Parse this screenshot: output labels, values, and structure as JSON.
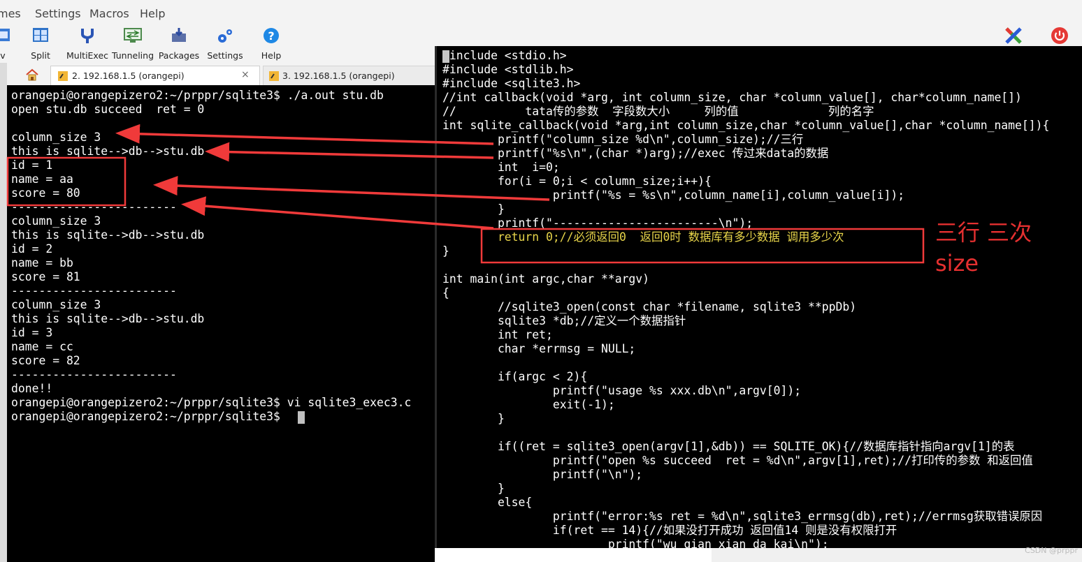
{
  "menu": [
    "mes",
    "Settings",
    "Macros",
    "Help"
  ],
  "toolbar": [
    {
      "label": "v",
      "icon": "view-icon"
    },
    {
      "label": "Split",
      "icon": "split-icon"
    },
    {
      "label": "MultiExec",
      "icon": "multiexec-icon"
    },
    {
      "label": "Tunneling",
      "icon": "tunneling-icon"
    },
    {
      "label": "Packages",
      "icon": "packages-icon"
    },
    {
      "label": "Settings",
      "icon": "settings-icon"
    },
    {
      "label": "Help",
      "icon": "help-icon"
    }
  ],
  "tabs": [
    {
      "label": "2. 192.168.1.5 (orangepi)",
      "close": "×"
    },
    {
      "label": "3. 192.168.1.5  (orangepi)"
    }
  ],
  "terminal": [
    "orangepi@orangepizero2:~/prppr/sqlite3$ ./a.out stu.db",
    "open stu.db succeed  ret = 0",
    "",
    "column_size 3",
    "this is sqlite-->db-->stu.db",
    "id = 1",
    "name = aa",
    "score = 80",
    "------------------------",
    "column_size 3",
    "this is sqlite-->db-->stu.db",
    "id = 2",
    "name = bb",
    "score = 81",
    "------------------------",
    "column_size 3",
    "this is sqlite-->db-->stu.db",
    "id = 3",
    "name = cc",
    "score = 82",
    "------------------------",
    "done!!",
    "orangepi@orangepizero2:~/prppr/sqlite3$ vi sqlite3_exec3.c",
    "orangepi@orangepizero2:~/prppr/sqlite3$ "
  ],
  "editor": {
    "l01": "#include <stdio.h>",
    "l02": "#include <stdlib.h>",
    "l03": "#include <sqlite3.h>",
    "l04": "//int callback(void *arg, int column_size, char *column_value[], char*column_name[])",
    "l05": "//          tata传的参数  字段数大小     列的值             列的名字",
    "l06": "int sqlite_callback(void *arg,int column_size,char *column_value[],char *column_name[]){",
    "l07": "        printf(\"column_size %d\\n\",column_size);//三行",
    "l08": "        printf(\"%s\\n\",(char *)arg);//exec 传过来data的数据",
    "l09": "        int  i=0;",
    "l10": "        for(i = 0;i < column_size;i++){",
    "l11": "                printf(\"%s = %s\\n\",column_name[i],column_value[i]);",
    "l12": "        }",
    "l13": "        printf(\"------------------------\\n\");",
    "l14": "        return 0;//必须返回0  返回0时 数据库有多少数据 调用多少次",
    "l15": "}",
    "l16": "",
    "l17": "int main(int argc,char **argv)",
    "l18": "{",
    "l19": "        //sqlite3_open(const char *filename, sqlite3 **ppDb)",
    "l20": "        sqlite3 *db;//定义一个数据指针",
    "l21": "        int ret;",
    "l22": "        char *errmsg = NULL;",
    "l23": "",
    "l24": "        if(argc < 2){",
    "l25": "                printf(\"usage %s xxx.db\\n\",argv[0]);",
    "l26": "                exit(-1);",
    "l27": "        }",
    "l28": "",
    "l29": "        if((ret = sqlite3_open(argv[1],&db)) == SQLITE_OK){//数据库指针指向argv[1]的表",
    "l30": "                printf(\"open %s succeed  ret = %d\\n\",argv[1],ret);//打印传的参数 和返回值",
    "l31": "                printf(\"\\n\");",
    "l32": "        }",
    "l33": "        else{",
    "l34": "                printf(\"error:%s ret = %d\\n\",sqlite3_errmsg(db),ret);//errmsg获取错误原因",
    "l35": "                if(ret == 14){//如果没打开成功 返回值14 则是没有权限打开",
    "l36": "                        printf(\"wu qian xian da kai\\n\");"
  },
  "annotation": {
    "line1": "三行 三次",
    "line2": "size"
  },
  "watermark": "CSDN @prppr",
  "colors": {
    "arrow": "#f03a3a",
    "box": "#f03a3a",
    "keyword": "#3c8ddc",
    "string": "#d63ad6",
    "comment": "#1f84d4"
  }
}
